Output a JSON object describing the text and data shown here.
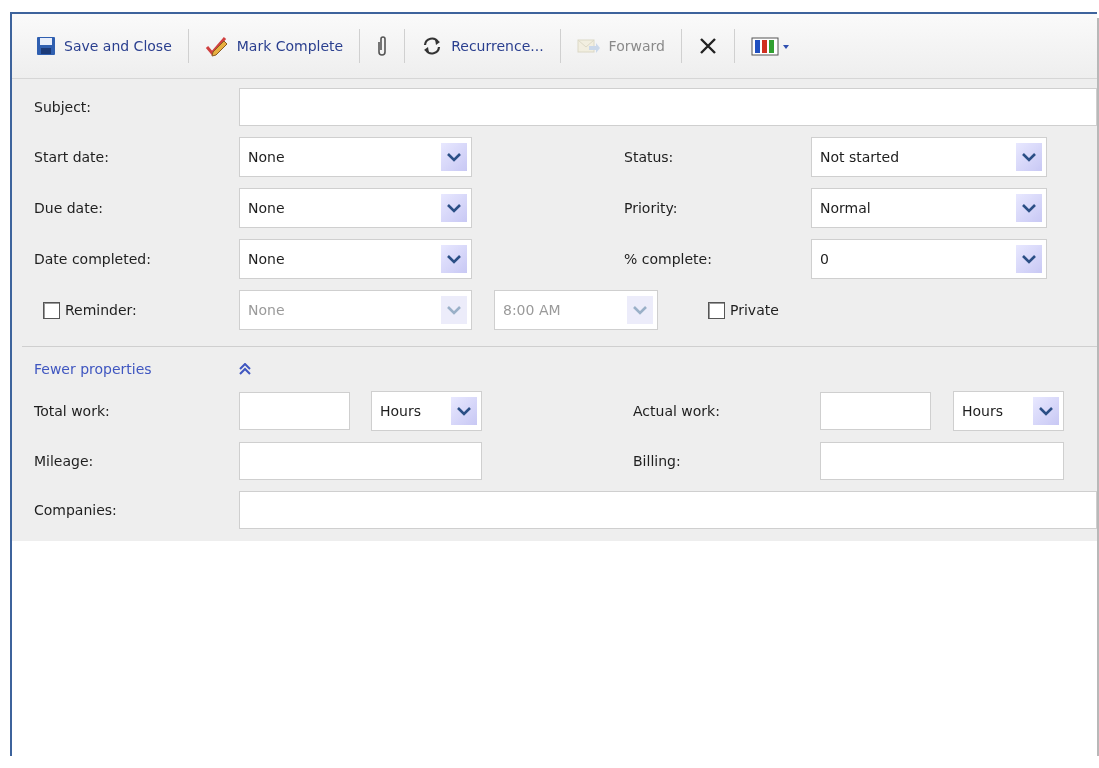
{
  "toolbar": {
    "items": [
      {
        "kind": "save",
        "label": "Save and Close",
        "disabled": false
      },
      {
        "kind": "mark",
        "label": "Mark Complete",
        "disabled": false
      },
      {
        "kind": "attach",
        "disabled": false
      },
      {
        "kind": "recur",
        "label": "Recurrence...",
        "disabled": false
      },
      {
        "kind": "forward",
        "label": "Forward",
        "disabled": true
      },
      {
        "kind": "delete",
        "disabled": false
      },
      {
        "kind": "categorize",
        "disabled": false
      }
    ]
  },
  "subject": {
    "label": "Subject:"
  },
  "left_fields": [
    {
      "label": "Start date:",
      "value": "None"
    },
    {
      "label": "Due date:",
      "value": "None"
    },
    {
      "label": "Date completed:",
      "value": "None"
    }
  ],
  "right_fields": [
    {
      "label": "Status:",
      "value": "Not started"
    },
    {
      "label": "Priority:",
      "value": "Normal"
    },
    {
      "label": "% complete:",
      "value": "0"
    }
  ],
  "reminder": {
    "label": "Reminder:",
    "checked": false,
    "date": {
      "value": "None",
      "disabled": true
    },
    "time": {
      "value": "8:00 AM",
      "disabled": true
    }
  },
  "private": {
    "label": "Private",
    "checked": false
  },
  "properties_toggle": {
    "label": "Fewer properties",
    "expanded": true
  },
  "total_work": {
    "label": "Total work:",
    "unit": "Hours"
  },
  "actual_work": {
    "label": "Actual work:",
    "unit": "Hours"
  },
  "mileage": {
    "label": "Mileage:"
  },
  "billing": {
    "label": "Billing:"
  },
  "companies": {
    "label": "Companies:"
  }
}
